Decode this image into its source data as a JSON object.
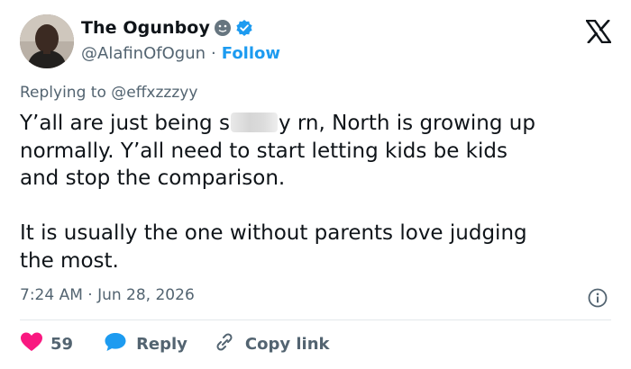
{
  "author": {
    "display_name": "The Ogunboy",
    "handle": "@AlafinOfOgun",
    "separator": "·",
    "follow_label": "Follow"
  },
  "reply_to": {
    "prefix": "Replying to",
    "mention": "@effxzzzyy"
  },
  "tweet": {
    "line1_part1": "Y’all are just being s",
    "line1_part2": "y rn, North is growing up",
    "rest": "normally. Y’all need to start letting kids be kids\nand stop the comparison.\n\nIt is usually the one without parents love judging\nthe most."
  },
  "meta": {
    "timestamp": "7:24 AM · Jun 28, 2026"
  },
  "actions": {
    "like_count": "59",
    "reply_label": "Reply",
    "copy_label": "Copy link"
  },
  "colors": {
    "accent": "#1d9bf0",
    "like": "#f91880",
    "text": "#0f1419",
    "secondary": "#536471"
  },
  "icons": [
    "emoji-icon",
    "verified-badge-icon",
    "x-logo-icon",
    "info-icon",
    "heart-icon",
    "reply-bubble-icon",
    "link-icon"
  ]
}
